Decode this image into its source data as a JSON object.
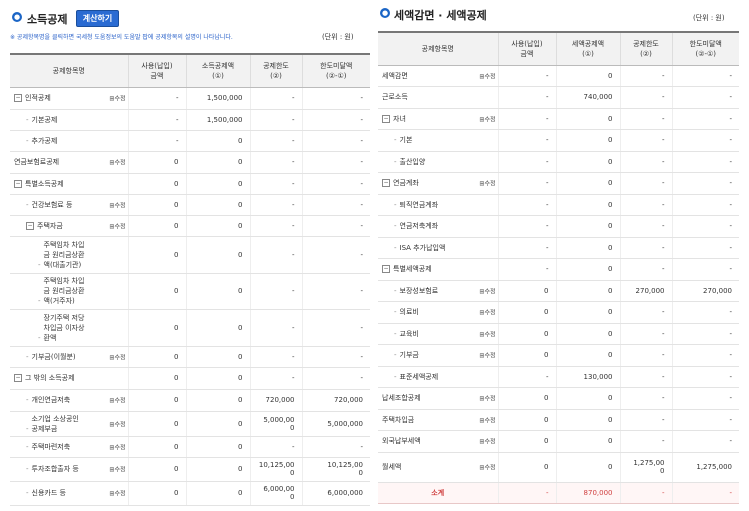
{
  "left": {
    "title": "소득공제",
    "calc_button": "계산하기",
    "notice": "※ 공제항목명을 클릭하면 국세청 도움정보의 도움말 팝에 공제항목의 설명이 나타납니다.",
    "unit": "(단위 : 원)",
    "headers": [
      "공제항목명",
      "사용(납입)\n금액",
      "소득공제액\n(①)",
      "공제한도\n(②)",
      "한도미달액\n(②-①)"
    ],
    "rows": [
      {
        "indent": 0,
        "marker": "box",
        "name": "인적공제",
        "mod": "수정",
        "used": "-",
        "amount": "1,500,000",
        "limit": "-",
        "short": "-",
        "h": 22
      },
      {
        "indent": 1,
        "marker": "dash",
        "name": "기본공제",
        "mod": "",
        "used": "-",
        "amount": "1,500,000",
        "limit": "-",
        "short": "-",
        "h": 21
      },
      {
        "indent": 1,
        "marker": "dash",
        "name": "추가공제",
        "mod": "",
        "used": "-",
        "amount": "0",
        "limit": "-",
        "short": "-",
        "h": 21
      },
      {
        "indent": 0,
        "marker": "",
        "name": "연금보험료공제",
        "mod": "수정",
        "used": "0",
        "amount": "0",
        "limit": "-",
        "short": "-",
        "h": 22
      },
      {
        "indent": 0,
        "marker": "box",
        "name": "특별소득공제",
        "mod": "",
        "used": "0",
        "amount": "0",
        "limit": "-",
        "short": "-",
        "h": 21
      },
      {
        "indent": 1,
        "marker": "dash",
        "name": "건강보험료 등",
        "mod": "수정",
        "used": "0",
        "amount": "0",
        "limit": "-",
        "short": "-",
        "h": 21
      },
      {
        "indent": 1,
        "marker": "box",
        "name": "주택자금",
        "mod": "수정",
        "used": "0",
        "amount": "0",
        "limit": "-",
        "short": "-",
        "h": 21
      },
      {
        "indent": 2,
        "marker": "dash",
        "name": "주택임차 차입\n금 원리금상환\n액(대출기관)",
        "mod": "",
        "used": "0",
        "amount": "0",
        "limit": "-",
        "short": "-",
        "h": 37
      },
      {
        "indent": 2,
        "marker": "dash",
        "name": "주택임차 차입\n금 원리금상환\n액(거주자)",
        "mod": "",
        "used": "0",
        "amount": "0",
        "limit": "-",
        "short": "-",
        "h": 36
      },
      {
        "indent": 2,
        "marker": "dash",
        "name": "장기주택 저당\n차입금 이자상\n환액",
        "mod": "",
        "used": "0",
        "amount": "0",
        "limit": "-",
        "short": "-",
        "h": 37
      },
      {
        "indent": 1,
        "marker": "dash",
        "name": "기부금(이월분)",
        "mod": "수정",
        "used": "0",
        "amount": "0",
        "limit": "-",
        "short": "-",
        "h": 21
      },
      {
        "indent": 0,
        "marker": "box",
        "name": "그 밖의 소득공제",
        "mod": "",
        "used": "0",
        "amount": "0",
        "limit": "-",
        "short": "-",
        "h": 22
      },
      {
        "indent": 1,
        "marker": "dash",
        "name": "개인연금저축",
        "mod": "수정",
        "used": "0",
        "amount": "0",
        "limit": "720,000",
        "short": "720,000",
        "h": 22
      },
      {
        "indent": 1,
        "marker": "dash",
        "name": "소기업 소상공인\n공제부금",
        "mod": "수정",
        "used": "0",
        "amount": "0",
        "limit": "5,000,00\n0",
        "short": "5,000,000",
        "h": 25
      },
      {
        "indent": 1,
        "marker": "dash",
        "name": "주택마련저축",
        "mod": "수정",
        "used": "0",
        "amount": "0",
        "limit": "-",
        "short": "-",
        "h": 21
      },
      {
        "indent": 1,
        "marker": "dash",
        "name": "투자조합출자 등",
        "mod": "수정",
        "used": "0",
        "amount": "0",
        "limit": "10,125,00\n0",
        "short": "10,125,00\n0",
        "h": 24
      },
      {
        "indent": 1,
        "marker": "dash",
        "name": "신용카드 등",
        "mod": "수정",
        "used": "0",
        "amount": "0",
        "limit": "6,000,00\n0",
        "short": "6,000,000",
        "h": 24
      }
    ]
  },
  "right": {
    "title": "세액감면 · 세액공제",
    "unit": "(단위 : 원)",
    "headers": [
      "공제항목명",
      "사용(납입)\n금액",
      "세액공제액\n(①)",
      "공제한도\n(②)",
      "한도미달액\n(②-①)"
    ],
    "rows": [
      {
        "indent": 0,
        "marker": "",
        "name": "세액감면",
        "mod": "수정",
        "used": "-",
        "amount": "0",
        "limit": "-",
        "short": "-",
        "h": 21
      },
      {
        "indent": 0,
        "marker": "",
        "name": "근로소득",
        "mod": "",
        "used": "-",
        "amount": "740,000",
        "limit": "-",
        "short": "-",
        "h": 22
      },
      {
        "indent": 0,
        "marker": "box",
        "name": "자녀",
        "mod": "수정",
        "used": "-",
        "amount": "0",
        "limit": "-",
        "short": "-",
        "h": 21
      },
      {
        "indent": 1,
        "marker": "dash",
        "name": "기본",
        "mod": "",
        "used": "-",
        "amount": "0",
        "limit": "-",
        "short": "-",
        "h": 22
      },
      {
        "indent": 1,
        "marker": "dash",
        "name": "출산입양",
        "mod": "",
        "used": "-",
        "amount": "0",
        "limit": "-",
        "short": "-",
        "h": 21
      },
      {
        "indent": 0,
        "marker": "box",
        "name": "연금계좌",
        "mod": "수정",
        "used": "-",
        "amount": "0",
        "limit": "-",
        "short": "-",
        "h": 22
      },
      {
        "indent": 1,
        "marker": "dash",
        "name": "퇴직연금계좌",
        "mod": "",
        "used": "-",
        "amount": "0",
        "limit": "-",
        "short": "-",
        "h": 21
      },
      {
        "indent": 1,
        "marker": "dash",
        "name": "연금저축계좌",
        "mod": "",
        "used": "-",
        "amount": "0",
        "limit": "-",
        "short": "-",
        "h": 22
      },
      {
        "indent": 1,
        "marker": "dash",
        "name": "ISA 추가납입액",
        "mod": "",
        "used": "-",
        "amount": "0",
        "limit": "-",
        "short": "-",
        "h": 21
      },
      {
        "indent": 0,
        "marker": "box",
        "name": "특별세액공제",
        "mod": "",
        "used": "-",
        "amount": "0",
        "limit": "-",
        "short": "-",
        "h": 22
      },
      {
        "indent": 1,
        "marker": "dash",
        "name": "보장성보험료",
        "mod": "수정",
        "used": "0",
        "amount": "0",
        "limit": "270,000",
        "short": "270,000",
        "h": 21
      },
      {
        "indent": 1,
        "marker": "dash",
        "name": "의료비",
        "mod": "수정",
        "used": "0",
        "amount": "0",
        "limit": "-",
        "short": "-",
        "h": 22
      },
      {
        "indent": 1,
        "marker": "dash",
        "name": "교육비",
        "mod": "수정",
        "used": "0",
        "amount": "0",
        "limit": "-",
        "short": "-",
        "h": 21
      },
      {
        "indent": 1,
        "marker": "dash",
        "name": "기부금",
        "mod": "수정",
        "used": "0",
        "amount": "0",
        "limit": "-",
        "short": "-",
        "h": 22
      },
      {
        "indent": 1,
        "marker": "dash",
        "name": "표준세액공제",
        "mod": "",
        "used": "-",
        "amount": "130,000",
        "limit": "-",
        "short": "-",
        "h": 21
      },
      {
        "indent": 0,
        "marker": "",
        "name": "납세조합공제",
        "mod": "수정",
        "used": "0",
        "amount": "0",
        "limit": "-",
        "short": "-",
        "h": 22
      },
      {
        "indent": 0,
        "marker": "",
        "name": "주택차입금",
        "mod": "수정",
        "used": "0",
        "amount": "0",
        "limit": "-",
        "short": "-",
        "h": 21
      },
      {
        "indent": 0,
        "marker": "",
        "name": "외국납부세액",
        "mod": "수정",
        "used": "0",
        "amount": "0",
        "limit": "-",
        "short": "-",
        "h": 22
      },
      {
        "indent": 0,
        "marker": "",
        "name": "월세액",
        "mod": "수정",
        "used": "0",
        "amount": "0",
        "limit": "1,275,00\n0",
        "short": "1,275,000",
        "h": 30
      }
    ],
    "total": {
      "name": "소계",
      "used": "-",
      "amount": "870,000",
      "limit": "-",
      "short": "-",
      "h": 21
    }
  }
}
